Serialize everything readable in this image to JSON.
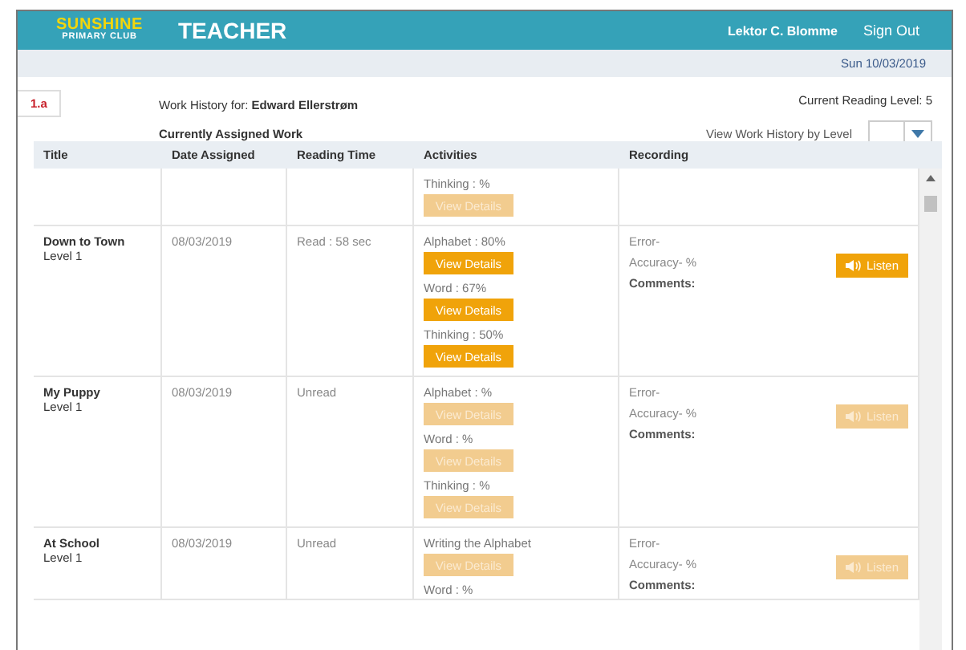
{
  "header": {
    "logo_top": "SUNSHINE",
    "logo_bottom": "PRIMARY CLUB",
    "title": "TEACHER",
    "user": "Lektor C. Blomme",
    "sign_out": "Sign Out"
  },
  "date": "Sun 10/03/2019",
  "info": {
    "badge": "1.a",
    "work_history_label": "Work History for:",
    "student": "Edward Ellerstrøm",
    "reading_level": "Current Reading Level: 5",
    "assigned_heading": "Currently Assigned Work",
    "history_by_level": "View Work History by Level"
  },
  "table": {
    "columns": [
      "Title",
      "Date Assigned",
      "Reading Time",
      "Activities",
      "Recording"
    ],
    "rows": [
      {
        "activities": [
          {
            "label": "Thinking : %",
            "button": "View Details",
            "disabled": true
          }
        ]
      },
      {
        "title": "Down to Town",
        "level": "Level 1",
        "date": "08/03/2019",
        "reading_time": "Read : 58 sec",
        "activities": [
          {
            "label": "Alphabet : 80%",
            "button": "View Details",
            "disabled": false
          },
          {
            "label": "Word : 67%",
            "button": "View Details",
            "disabled": false
          },
          {
            "label": "Thinking : 50%",
            "button": "View Details",
            "disabled": false
          }
        ],
        "recording": {
          "error": "Error-",
          "accuracy": "Accuracy- %",
          "comments": "Comments:",
          "listen": "Listen",
          "disabled": false
        }
      },
      {
        "title": "My Puppy",
        "level": "Level 1",
        "date": "08/03/2019",
        "reading_time": "Unread",
        "activities": [
          {
            "label": "Alphabet : %",
            "button": "View Details",
            "disabled": true
          },
          {
            "label": "Word : %",
            "button": "View Details",
            "disabled": true
          },
          {
            "label": "Thinking : %",
            "button": "View Details",
            "disabled": true
          }
        ],
        "recording": {
          "error": "Error-",
          "accuracy": "Accuracy- %",
          "comments": "Comments:",
          "listen": "Listen",
          "disabled": true
        }
      },
      {
        "title": "At School",
        "level": "Level 1",
        "date": "08/03/2019",
        "reading_time": "Unread",
        "activities": [
          {
            "label": "Writing the Alphabet",
            "button": "View Details",
            "disabled": true
          },
          {
            "label": "Word : %"
          }
        ],
        "recording": {
          "error": "Error-",
          "accuracy": "Accuracy- %",
          "comments": "Comments:",
          "listen": "Listen",
          "disabled": true
        }
      }
    ]
  }
}
